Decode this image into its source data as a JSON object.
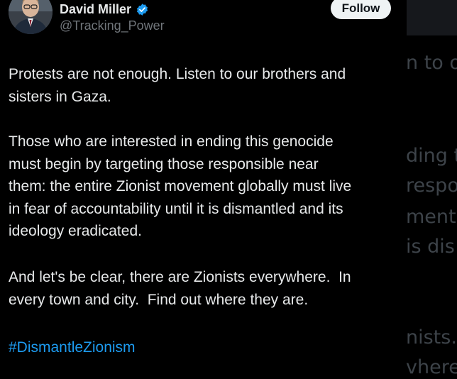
{
  "author": {
    "name": "David Miller",
    "handle": "@Tracking_Power",
    "verified_icon": "verified-badge-icon",
    "avatar_icon": "profile-avatar"
  },
  "follow_label": "Follow",
  "post": {
    "paragraphs": [
      "Protests are not enough. Listen to our brothers and\nsisters in Gaza.",
      "Those who are interested in ending this genocide\nmust begin by targeting those responsible near\nthem: the entire Zionist movement globally must live\nin fear of accountability until it is dismantled and its\nideology eradicated.",
      "And let's be clear, there are Zionists everywhere.  In\nevery town and city.  Find out where they are."
    ],
    "hashtag": "#DismantleZionism"
  },
  "background_fragments": [
    "n to o",
    "ding t",
    "respo",
    "ment g",
    "is dis",
    "nists.",
    "vhere"
  ],
  "colors": {
    "background": "#000000",
    "text": "#e7e9ea",
    "muted": "#71767b",
    "link": "#1d9bf0",
    "verified": "#1d9bf0",
    "button_bg": "#eff3f4"
  }
}
